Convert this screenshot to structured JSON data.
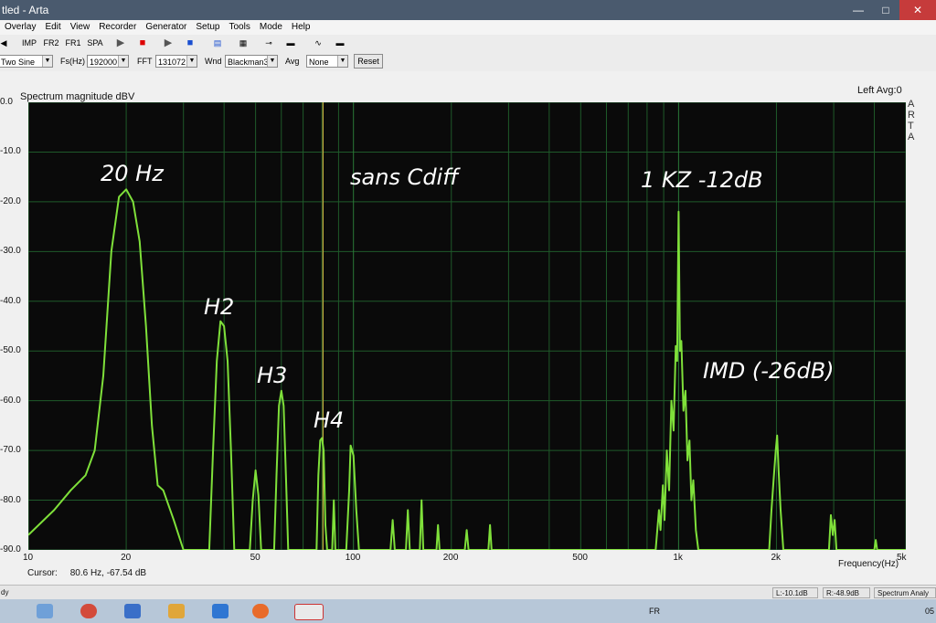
{
  "window": {
    "title": "tled - Arta"
  },
  "menu": [
    "Overlay",
    "Edit",
    "View",
    "Recorder",
    "Generator",
    "Setup",
    "Tools",
    "Mode",
    "Help"
  ],
  "toolbar": {
    "imp": "IMP",
    "fr2": "FR2",
    "fr1": "FR1",
    "spa": "SPA"
  },
  "controls": {
    "signal": "Two Sine",
    "fs_label": "Fs(Hz)",
    "fs_value": "192000",
    "fft_label": "FFT",
    "fft_value": "131072",
    "wnd_label": "Wnd",
    "wnd_value": "Blackman3",
    "avg_label": "Avg",
    "avg_value": "None",
    "reset_label": "Reset"
  },
  "plot": {
    "title": "Spectrum magnitude dBV",
    "top_right": "Left  Avg:0",
    "side_label": [
      "A",
      "R",
      "T",
      "A"
    ],
    "cursor_label": "Cursor:",
    "cursor_value": "80.6 Hz, -67.54 dB"
  },
  "status": {
    "left": "dy",
    "l_value": "L:-10.1dB",
    "r_value": "R:-48.9dB",
    "mode": "Spectrum Analy"
  },
  "taskbar": {
    "lang": "FR",
    "clock": "05"
  },
  "chart_data": {
    "type": "line",
    "title": "Spectrum magnitude dBV",
    "xlabel": "Frequency(Hz)",
    "ylabel": "",
    "x_scale": "log",
    "xlim": [
      10,
      5000
    ],
    "ylim": [
      -90,
      0
    ],
    "y_ticks": [
      0,
      -10,
      -20,
      -30,
      -40,
      -50,
      -60,
      -70,
      -80,
      -90
    ],
    "y_tick_labels": [
      "0.0",
      "-10.0",
      "-20.0",
      "-30.0",
      "-40.0",
      "-50.0",
      "-60.0",
      "-70.0",
      "-80.0",
      "-90.0"
    ],
    "x_ticks": [
      10,
      20,
      50,
      100,
      200,
      500,
      1000,
      2000,
      5000
    ],
    "x_tick_labels": [
      "10",
      "20",
      "50",
      "100",
      "200",
      "500",
      "1k",
      "2k",
      "5k"
    ],
    "grid": true,
    "cursor_x": 80.6,
    "line_color": "#7fe03a",
    "series": [
      {
        "values_xy": [
          [
            10,
            -87
          ],
          [
            12,
            -82
          ],
          [
            13.5,
            -78
          ],
          [
            15,
            -75
          ],
          [
            16,
            -70
          ],
          [
            17,
            -55
          ],
          [
            18,
            -30
          ],
          [
            19,
            -19
          ],
          [
            20,
            -17.5
          ],
          [
            21,
            -20
          ],
          [
            22,
            -28
          ],
          [
            23,
            -45
          ],
          [
            24,
            -65
          ],
          [
            25,
            -77
          ],
          [
            26,
            -78
          ],
          [
            28,
            -84
          ],
          [
            30,
            -90
          ],
          [
            36,
            -90
          ],
          [
            37,
            -70
          ],
          [
            38,
            -52
          ],
          [
            39,
            -44
          ],
          [
            40,
            -45
          ],
          [
            41,
            -52
          ],
          [
            42,
            -70
          ],
          [
            43,
            -90
          ],
          [
            48,
            -90
          ],
          [
            49,
            -80
          ],
          [
            50,
            -74
          ],
          [
            51,
            -79
          ],
          [
            52,
            -90
          ],
          [
            57,
            -90
          ],
          [
            58,
            -75
          ],
          [
            59,
            -61
          ],
          [
            60,
            -58
          ],
          [
            61,
            -61
          ],
          [
            62,
            -75
          ],
          [
            63,
            -90
          ],
          [
            77,
            -90
          ],
          [
            78,
            -75
          ],
          [
            79,
            -68
          ],
          [
            80,
            -67.5
          ],
          [
            81,
            -70
          ],
          [
            82,
            -85
          ],
          [
            83,
            -90
          ],
          [
            86,
            -90
          ],
          [
            87,
            -80
          ],
          [
            88,
            -90
          ],
          [
            95,
            -90
          ],
          [
            97,
            -78
          ],
          [
            98,
            -69
          ],
          [
            100,
            -71
          ],
          [
            102,
            -82
          ],
          [
            104,
            -90
          ],
          [
            130,
            -90
          ],
          [
            132,
            -84
          ],
          [
            134,
            -90
          ],
          [
            145,
            -90
          ],
          [
            147,
            -82
          ],
          [
            149,
            -90
          ],
          [
            160,
            -90
          ],
          [
            162,
            -80
          ],
          [
            164,
            -90
          ],
          [
            180,
            -90
          ],
          [
            182,
            -85
          ],
          [
            184,
            -90
          ],
          [
            220,
            -90
          ],
          [
            223,
            -86
          ],
          [
            226,
            -90
          ],
          [
            260,
            -90
          ],
          [
            263,
            -85
          ],
          [
            266,
            -90
          ],
          [
            850,
            -90
          ],
          [
            870,
            -82
          ],
          [
            880,
            -86
          ],
          [
            895,
            -77
          ],
          [
            905,
            -84
          ],
          [
            920,
            -70
          ],
          [
            935,
            -78
          ],
          [
            950,
            -60
          ],
          [
            965,
            -66
          ],
          [
            980,
            -49
          ],
          [
            990,
            -52
          ],
          [
            1000,
            -22
          ],
          [
            1010,
            -50
          ],
          [
            1020,
            -48
          ],
          [
            1035,
            -62
          ],
          [
            1050,
            -58
          ],
          [
            1065,
            -72
          ],
          [
            1080,
            -68
          ],
          [
            1095,
            -80
          ],
          [
            1110,
            -76
          ],
          [
            1130,
            -86
          ],
          [
            1150,
            -90
          ],
          [
            1900,
            -90
          ],
          [
            1930,
            -82
          ],
          [
            1960,
            -76
          ],
          [
            1990,
            -70
          ],
          [
            2010,
            -67
          ],
          [
            2030,
            -74
          ],
          [
            2060,
            -82
          ],
          [
            2100,
            -90
          ],
          [
            2900,
            -90
          ],
          [
            2940,
            -83
          ],
          [
            2980,
            -87
          ],
          [
            3020,
            -84
          ],
          [
            3060,
            -90
          ],
          [
            4000,
            -90
          ],
          [
            4040,
            -88
          ],
          [
            4080,
            -90
          ],
          [
            5000,
            -90
          ]
        ]
      }
    ]
  },
  "annotations": {
    "a20hz": "20 Hz",
    "sans": "sans Cdiff",
    "onekz": "1 KZ  -12dB",
    "h2": "H2",
    "h3": "H3",
    "h4": "H4",
    "imd": "IMD (-26dB)"
  }
}
